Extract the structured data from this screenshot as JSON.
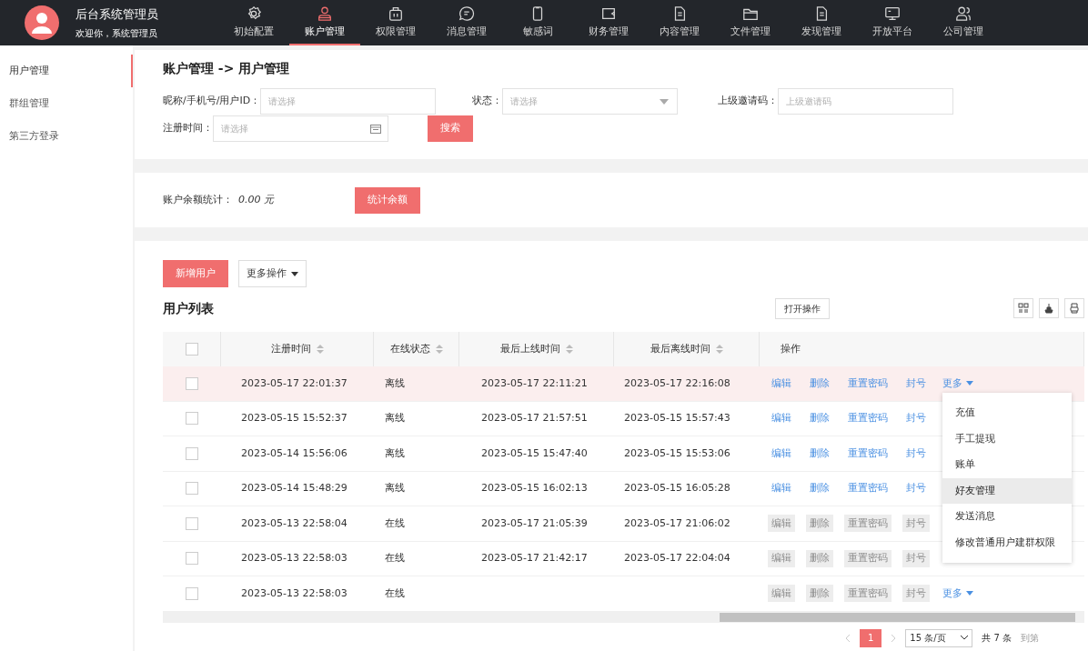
{
  "header": {
    "title": "后台系统管理员",
    "welcome": "欢迎你，系统管理员"
  },
  "nav": [
    {
      "label": "初始配置",
      "selected": false
    },
    {
      "label": "账户管理",
      "selected": true
    },
    {
      "label": "权限管理",
      "selected": false
    },
    {
      "label": "消息管理",
      "selected": false
    },
    {
      "label": "敏感词",
      "selected": false
    },
    {
      "label": "财务管理",
      "selected": false
    },
    {
      "label": "内容管理",
      "selected": false
    },
    {
      "label": "文件管理",
      "selected": false
    },
    {
      "label": "发现管理",
      "selected": false
    },
    {
      "label": "开放平台",
      "selected": false
    },
    {
      "label": "公司管理",
      "selected": false
    }
  ],
  "sidebar": {
    "items": [
      {
        "label": "用户管理",
        "selected": true
      },
      {
        "label": "群组管理",
        "selected": false
      },
      {
        "label": "第三方登录",
        "selected": false
      }
    ]
  },
  "breadcrumb": "账户管理 -> 用户管理",
  "filters": {
    "keyword": {
      "label": "昵称/手机号/用户ID：",
      "placeholder": "请选择"
    },
    "status": {
      "label": "状态：",
      "placeholder": "请选择"
    },
    "invite": {
      "label": "上级邀请码：",
      "placeholder": "上级邀请码"
    },
    "reg_time": {
      "label": "注册时间：",
      "placeholder": "请选择"
    },
    "search_button": "搜索"
  },
  "balance": {
    "label": "账户余额统计：",
    "value": "0.00 元",
    "button": "统计余额"
  },
  "toolbar": {
    "add_button": "新增用户",
    "more_button": "更多操作",
    "list_title": "用户列表",
    "open_ops_button": "打开操作"
  },
  "table": {
    "select_all": false,
    "columns": [
      {
        "label": "注册时间",
        "sortable": true
      },
      {
        "label": "在线状态",
        "sortable": true
      },
      {
        "label": "最后上线时间",
        "sortable": true
      },
      {
        "label": "最后离线时间",
        "sortable": true
      },
      {
        "label": "操作",
        "sortable": false
      }
    ],
    "rows": [
      {
        "checked": false,
        "registered": "2023-05-17 22:01:37",
        "status": "离线",
        "last_online": "2023-05-17 22:11:21",
        "last_offline": "2023-05-17 22:16:08",
        "highlighted": true,
        "disabled": false,
        "actions": [
          "编辑",
          "删除",
          "重置密码",
          "封号"
        ],
        "more": "更多"
      },
      {
        "checked": false,
        "registered": "2023-05-15 15:52:37",
        "status": "离线",
        "last_online": "2023-05-17 21:57:51",
        "last_offline": "2023-05-15 15:57:43",
        "highlighted": false,
        "disabled": false,
        "actions": [
          "编辑",
          "删除",
          "重置密码",
          "封号"
        ]
      },
      {
        "checked": false,
        "registered": "2023-05-14 15:56:06",
        "status": "离线",
        "last_online": "2023-05-15 15:47:40",
        "last_offline": "2023-05-15 15:53:06",
        "highlighted": false,
        "disabled": false,
        "actions": [
          "编辑",
          "删除",
          "重置密码",
          "封号"
        ]
      },
      {
        "checked": false,
        "registered": "2023-05-14 15:48:29",
        "status": "离线",
        "last_online": "2023-05-15 16:02:13",
        "last_offline": "2023-05-15 16:05:28",
        "highlighted": false,
        "disabled": false,
        "actions": [
          "编辑",
          "删除",
          "重置密码",
          "封号"
        ]
      },
      {
        "checked": false,
        "registered": "2023-05-13 22:58:04",
        "status": "在线",
        "last_online": "2023-05-17 21:05:39",
        "last_offline": "2023-05-17 21:06:02",
        "highlighted": false,
        "disabled": true,
        "actions": [
          "编辑",
          "删除",
          "重置密码",
          "封号"
        ]
      },
      {
        "checked": false,
        "registered": "2023-05-13 22:58:03",
        "status": "在线",
        "last_online": "2023-05-17 21:42:17",
        "last_offline": "2023-05-17 22:04:04",
        "highlighted": false,
        "disabled": true,
        "actions": [
          "编辑",
          "删除",
          "重置密码",
          "封号"
        ]
      },
      {
        "checked": false,
        "registered": "2023-05-13 22:58:03",
        "status": "在线",
        "last_online": "",
        "last_offline": "",
        "highlighted": false,
        "disabled": true,
        "actions": [
          "编辑",
          "删除",
          "重置密码",
          "封号"
        ],
        "more": "更多"
      }
    ]
  },
  "dropdown": {
    "items": [
      {
        "label": "充值",
        "highlighted": false
      },
      {
        "label": "手工提现",
        "highlighted": false
      },
      {
        "label": "账单",
        "highlighted": false
      },
      {
        "label": "好友管理",
        "highlighted": true
      },
      {
        "label": "发送消息",
        "highlighted": false
      },
      {
        "label": "修改普通用户建群权限",
        "highlighted": false
      }
    ]
  },
  "pagination": {
    "pages": [
      {
        "label": "1",
        "selected": true
      }
    ],
    "page_size": "15 条/页",
    "total": "共 7 条",
    "goto": "到第"
  }
}
